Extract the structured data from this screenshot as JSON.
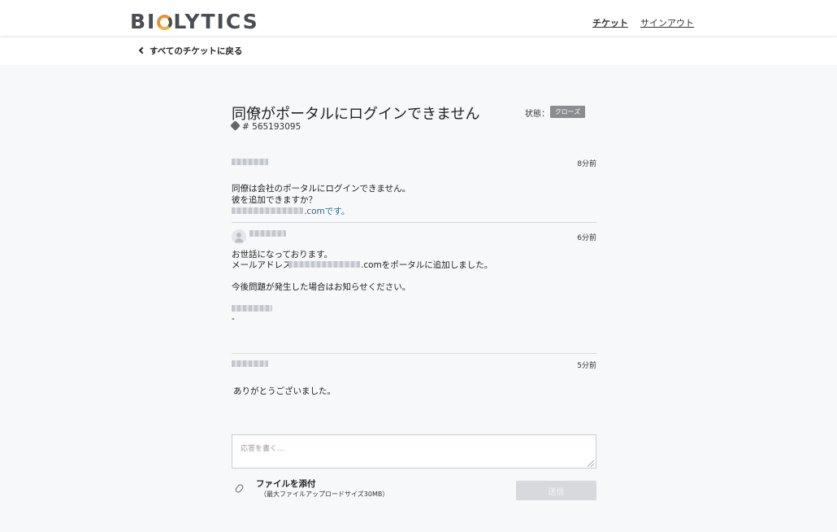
{
  "header": {
    "logo": {
      "pre": "BI",
      "post": "LYTICS"
    },
    "nav_tickets": "チケット",
    "nav_signout": "サインアウト"
  },
  "back_link": "すべてのチケットに戻る",
  "ticket": {
    "title": "同僚がポータルにログインできません",
    "number": "# 565193095",
    "status_label": "状態：",
    "status": "クローズ"
  },
  "messages": [
    {
      "time": "8分前",
      "lines": [
        "同僚は会社のポータルにログインできません。",
        "彼を追加できますか？"
      ],
      "email_suffix": ".comです。"
    },
    {
      "time": "6分前",
      "line1": "お世話になっております。",
      "line2_prefix": "メールアドレス",
      "line2_suffix": ".comをポータルに追加しました。",
      "line3": "今後問題が発生した場合はお知らせください。",
      "dash": "-"
    },
    {
      "time": "5分前",
      "text": "ありがとうございました。"
    }
  ],
  "reply": {
    "placeholder": "応答を書く...",
    "attach_label": "ファイルを添付",
    "attach_note": "（最大ファイルアップロードサイズ30MB）",
    "send": "送信"
  },
  "icons": {
    "back": "chevron-left-icon",
    "ticket": "tag-icon",
    "avatar": "user-icon",
    "attach": "paperclip-icon"
  },
  "colors": {
    "logo_accent": "#e9932b",
    "status_badge": "#8a8c90",
    "link": "#2c6b8a"
  }
}
